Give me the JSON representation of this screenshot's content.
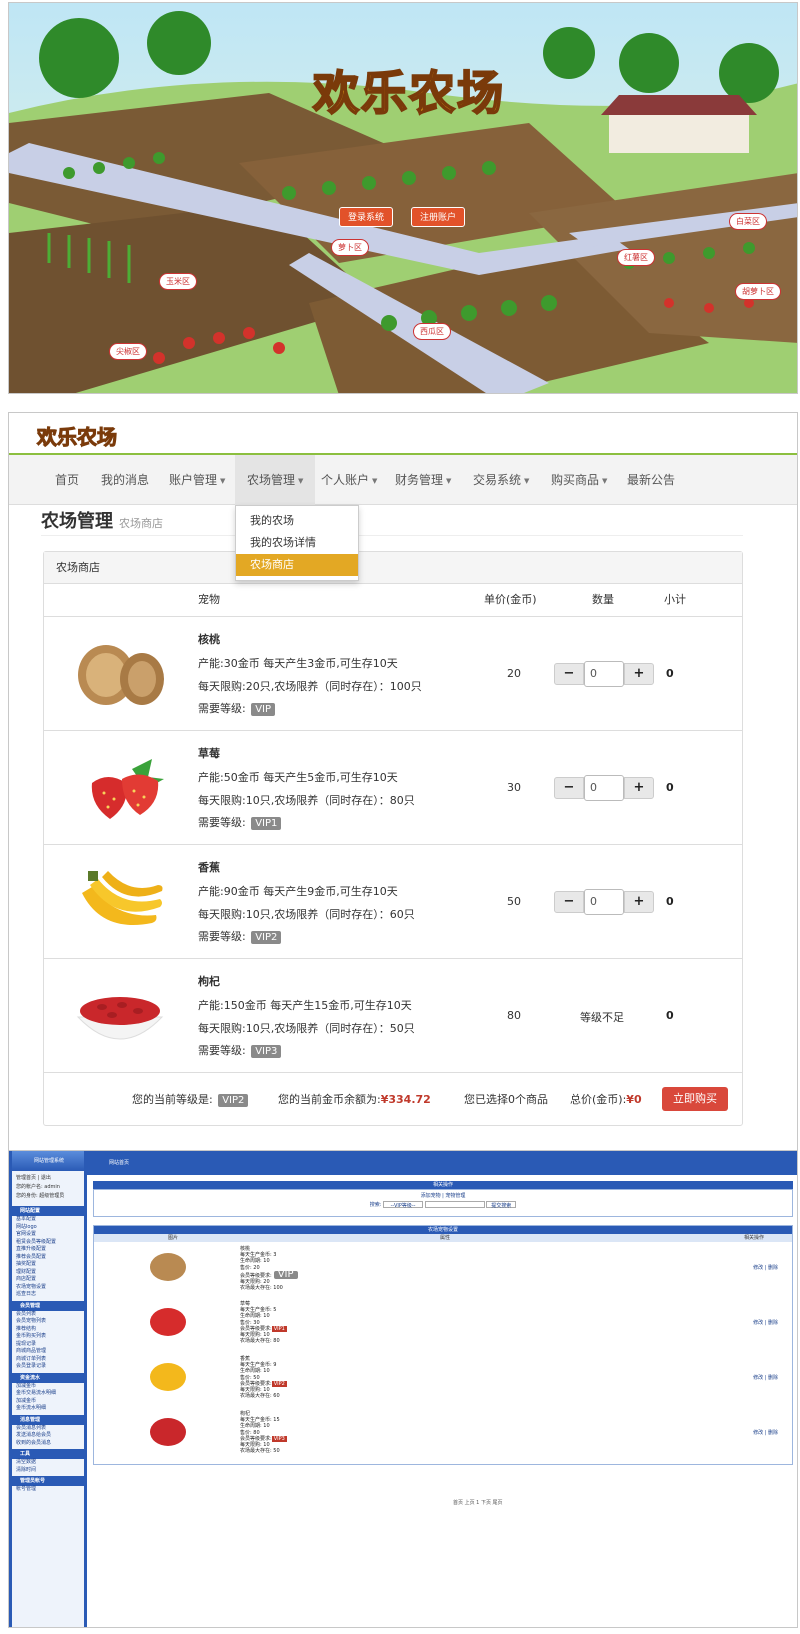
{
  "banner": {
    "logo_text": "欢乐农场",
    "login_button": "登录系统",
    "register_button": "注册账户",
    "zones": [
      "胡萝卜区",
      "玉米区",
      "尖椒区",
      "萝卜区",
      "西瓜区",
      "红薯区",
      "白菜区",
      "胡萝卜区"
    ]
  },
  "shop_page": {
    "logo_text": "欢乐农场",
    "nav": [
      {
        "label": "首页",
        "caret": ""
      },
      {
        "label": "我的消息",
        "caret": ""
      },
      {
        "label": "账户管理",
        "caret": "▼"
      },
      {
        "label": "农场管理",
        "caret": "▼"
      },
      {
        "label": "个人账户",
        "caret": "▼"
      },
      {
        "label": "财务管理",
        "caret": "▼"
      },
      {
        "label": "交易系统",
        "caret": "▼"
      },
      {
        "label": "购买商品",
        "caret": "▼"
      },
      {
        "label": "最新公告",
        "caret": ""
      }
    ],
    "dropdown": [
      "我的农场",
      "我的农场详情",
      "农场商店"
    ],
    "page_title": "农场管理",
    "page_subtitle": "农场商店",
    "box_title": "农场商店",
    "columns": {
      "pet": "宠物",
      "price": "单价(金币)",
      "qty": "数量",
      "subtotal": "小计"
    },
    "level_label": "需要等级:",
    "products": [
      {
        "name": "核桃",
        "line1": "产能:30金币 每天产生3金币,可生存10天",
        "line2": "每天限购:20只,农场限养（同时存在）：100只",
        "vip": "VIP",
        "price": "20",
        "qty": "0",
        "level_msg": "",
        "subtotal": "0"
      },
      {
        "name": "草莓",
        "line1": "产能:50金币 每天产生5金币,可生存10天",
        "line2": "每天限购:10只,农场限养（同时存在）：80只",
        "vip": "VIP1",
        "price": "30",
        "qty": "0",
        "level_msg": "",
        "subtotal": "0"
      },
      {
        "name": "香蕉",
        "line1": "产能:90金币 每天产生9金币,可生存10天",
        "line2": "每天限购:10只,农场限养（同时存在）：60只",
        "vip": "VIP2",
        "price": "50",
        "qty": "0",
        "level_msg": "",
        "subtotal": "0"
      },
      {
        "name": "枸杞",
        "line1": "产能:150金币 每天产生15金币,可生存10天",
        "line2": "每天限购:10只,农场限养（同时存在）：50只",
        "vip": "VIP3",
        "price": "80",
        "qty": "",
        "level_msg": "等级不足",
        "subtotal": "0"
      }
    ],
    "footer": {
      "level_text": "您的当前等级是:",
      "level_value": "VIP2",
      "balance_text": "您的当前金币余额为:",
      "balance_value": "¥334.72",
      "selected_text": "您已选择0个商品",
      "total_text": "总价(金币):",
      "total_value": "¥0",
      "buy_button": "立即购买"
    },
    "stepper_minus": "−",
    "stepper_plus": "+"
  },
  "admin_page": {
    "side_title": "网站管理系统",
    "top_links": "管理首页 | 退出",
    "user_line": "您的帐户名: admin",
    "role_line": "您的身份: 超级管理员",
    "header_tab": "网站首页",
    "groups": [
      {
        "title": "网站配置",
        "items": [
          "基本配置",
          "网站logo",
          "官网设置",
          "租赁会员等级配置",
          "直推升级配置",
          "推荐会员配置",
          "抽奖配置",
          "理财配置",
          "商店配置",
          "农场宠物设置",
          "巡查日志"
        ]
      },
      {
        "title": "会员管理",
        "items": [
          "会员列表",
          "会员宠物列表",
          "推荐结构",
          "金币购买列表",
          "提现记录",
          "商城商品管理",
          "商城订单列表",
          "会员登录记录"
        ]
      },
      {
        "title": "资金流水",
        "items": [
          "加减金币",
          "金币交易流水明细",
          "加减金币",
          "金币流水明细"
        ]
      },
      {
        "title": "消息管理",
        "items": [
          "会员消息列表",
          "发送消息给会员",
          "收到的会员消息"
        ]
      },
      {
        "title": "工具",
        "items": [
          "清空数据",
          "清除时间"
        ]
      },
      {
        "title": "管理员帐号",
        "items": [
          "帐号管理"
        ]
      }
    ],
    "ops_title": "相关操作",
    "ops_links": "添加宠物 | 宠物管理",
    "search_label": "搜索:",
    "search_select": "--VIP等级--",
    "search_button": "提交搜索",
    "table_title": "农场宠物设置",
    "table_cols": [
      "图片",
      "属性",
      "相关操作"
    ],
    "rows": [
      {
        "name": "核桃",
        "lines": [
          "每天生产金币: 3",
          "生命周期: 10",
          "售价: 20",
          "会员等级要求:",
          "每天限购: 20",
          "农场最大存在: 100"
        ],
        "vip": "VIP"
      },
      {
        "name": "草莓",
        "lines": [
          "每天生产金币: 5",
          "生命周期: 10",
          "售价: 30",
          "会员等级要求:",
          "每天限购: 10",
          "农场最大存在: 80"
        ],
        "vip": "VIP1"
      },
      {
        "name": "香蕉",
        "lines": [
          "每天生产金币: 9",
          "生命周期: 10",
          "售价: 50",
          "会员等级要求:",
          "每天限购: 10",
          "农场最大存在: 60"
        ],
        "vip": "VIP2"
      },
      {
        "name": "枸杞",
        "lines": [
          "每天生产金币: 15",
          "生命周期: 10",
          "售价: 80",
          "会员等级要求:",
          "每天限购: 10",
          "农场最大存在: 50"
        ],
        "vip": "VIP3"
      }
    ],
    "row_ops": "修改 | 删除",
    "pager": "首页 上页 1 下页 尾页"
  }
}
